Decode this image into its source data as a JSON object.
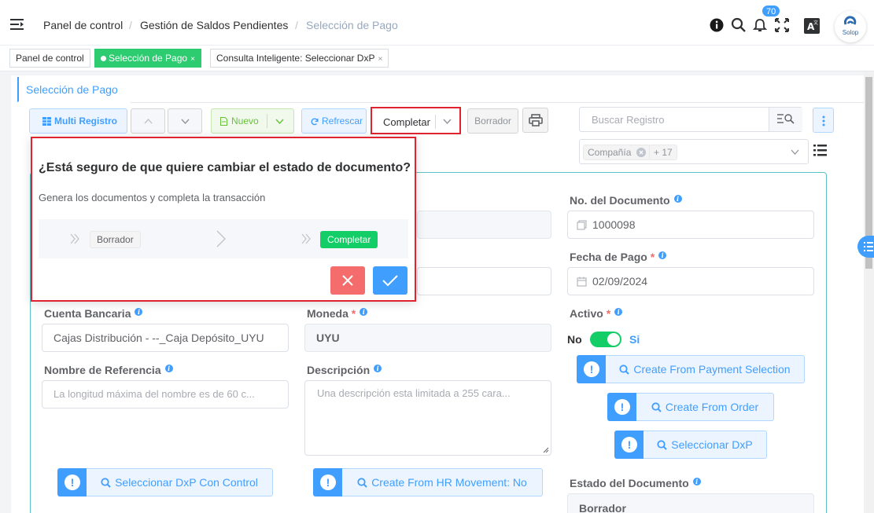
{
  "breadcrumb": {
    "items": [
      "Panel de control",
      "Gestión de Saldos Pendientes",
      "Selección de Pago"
    ],
    "separator": "/"
  },
  "header": {
    "notification_count": "70",
    "logo_text": "Solop"
  },
  "tabs": [
    {
      "label": "Panel de control"
    },
    {
      "label": "Selección de Pago",
      "close": "×"
    },
    {
      "label": "Consulta Inteligente: Seleccionar DxP",
      "close": "×"
    }
  ],
  "panel_tab": "Selección de Pago",
  "toolbar": {
    "multi_registro": "Multi Registro",
    "nuevo": "Nuevo",
    "refrescar": "Refrescar",
    "completar": "Completar",
    "borrador": "Borrador"
  },
  "search": {
    "placeholder": "Buscar Registro"
  },
  "filter": {
    "chip": "Compañía",
    "more": "+ 17"
  },
  "form": {
    "no_documento_label": "No. del Documento",
    "no_documento_value": "1000098",
    "fecha_pago_label": "Fecha de Pago",
    "fecha_pago_value": "02/09/2024",
    "cuenta_bancaria_label": "Cuenta Bancaria",
    "cuenta_bancaria_value": "Cajas Distribución - --_Caja Depósito_UYU",
    "moneda_label": "Moneda",
    "moneda_value": "UYU",
    "activo_label": "Activo",
    "activo_off": "No",
    "activo_on": "Si",
    "nombre_ref_label": "Nombre de Referencia",
    "nombre_ref_placeholder": "La longitud máxima del nombre es de 60 c...",
    "descripcion_label": "Descripción",
    "descripcion_placeholder": "Una descripción esta limitada a 255 cara...",
    "estado_label": "Estado del Documento",
    "estado_value": "Borrador",
    "required_mark": "*"
  },
  "actions": {
    "create_from_payment": "Create From Payment Selection",
    "create_from_order": "Create From Order",
    "seleccionar_dxp": "Seleccionar DxP",
    "seleccionar_dxp_control": "Seleccionar DxP Con Control",
    "create_from_hr": "Create From HR Movement: No"
  },
  "dialog": {
    "title": "¿Está seguro de que quiere cambiar el estado de documento?",
    "message": "Genera los documentos y completa la transacción",
    "from_state": "Borrador",
    "to_state": "Completar"
  },
  "colors": {
    "primary": "#409eff",
    "success": "#13ce66",
    "danger": "#f56c6c",
    "highlight_border": "#e0242f"
  }
}
